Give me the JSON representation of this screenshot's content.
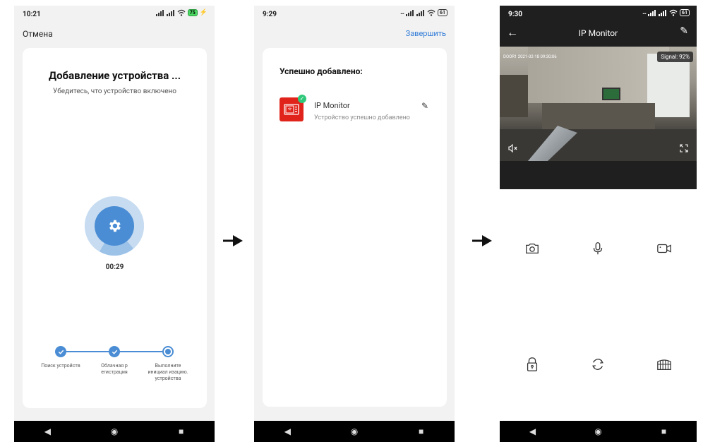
{
  "panel1": {
    "status_time": "10:21",
    "battery": "75",
    "cancel_label": "Отмена",
    "title": "Добавление устройства ...",
    "subtitle": "Убедитесь, что устройство включено",
    "timer": "00:29",
    "steps": [
      {
        "label": "Поиск устройств",
        "state": "done"
      },
      {
        "label": "Облачная р егистрация",
        "state": "done"
      },
      {
        "label": "Выполните инициал изацию. устройства",
        "state": "active"
      }
    ]
  },
  "panel2": {
    "status_time": "9:29",
    "battery": "61",
    "finish_label": "Завершить",
    "title": "Успешно добавлено:",
    "device_name": "IP Monitor",
    "device_status": "Устройство успешно добавлено"
  },
  "panel3": {
    "status_time": "9:30",
    "battery": "61",
    "title": "IP Monitor",
    "osd_text": "DOOR1 2021-02-18 09:30:06",
    "signal_text": "Signal: 92%",
    "controls": [
      "camera-icon",
      "microphone-icon",
      "video-record-icon",
      "lock-icon",
      "rotate-icon",
      "gate-icon"
    ]
  },
  "colors": {
    "accent": "#4a8dd4",
    "link": "#2f7bd8",
    "device_red": "#e0241b",
    "success": "#2fc87a"
  }
}
